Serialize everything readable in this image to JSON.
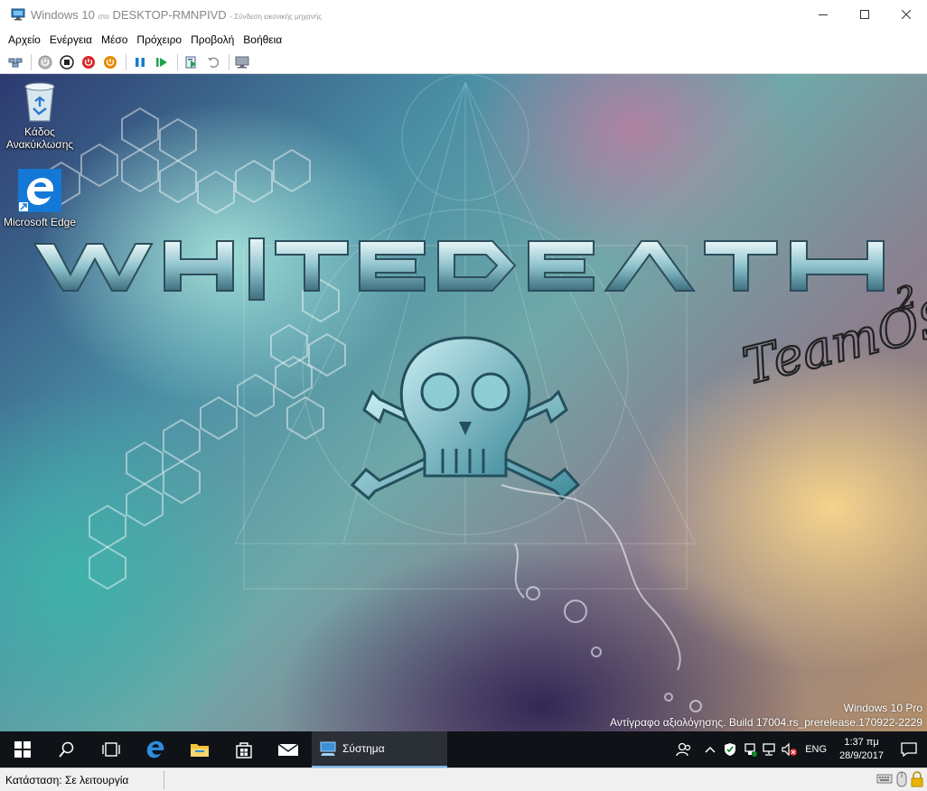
{
  "titlebar": {
    "title": "Windows 10",
    "on": "στο",
    "host": "DESKTOP-RMNPIVD",
    "subtitle": "- Σύνδεση εικονικής μηχανής",
    "icon": "vm-connection-icon",
    "controls": [
      "minimize-icon",
      "maximize-icon",
      "close-icon"
    ]
  },
  "menubar": {
    "items": [
      "Αρχείο",
      "Ενέργεια",
      "Μέσο",
      "Πρόχειρο",
      "Προβολή",
      "Βοήθεια"
    ]
  },
  "toolbar": {
    "buttons": [
      "ctrl-alt-del-icon",
      "start-icon",
      "turn-off-icon",
      "shutdown-icon",
      "save-icon",
      "pause-icon",
      "resume-icon",
      "checkpoint-icon",
      "revert-icon",
      "enhanced-session-icon"
    ],
    "colors": {
      "red": "#d9262b",
      "orange": "#e68a00",
      "blue": "#1a7cc9",
      "green": "#1aa64a"
    }
  },
  "desktop": {
    "icons": [
      {
        "label_line1": "Κάδος",
        "label_line2": "Ανακύκλωσης",
        "icon": "recycle-bin-icon"
      },
      {
        "label_line1": "Microsoft Edge",
        "label_line2": "",
        "icon": "edge-icon"
      }
    ],
    "wallpaper_text": "WHITEDEATH",
    "wallpaper_sub": "TeamOS",
    "wallpaper_sub2": "2",
    "watermark_line1": "Windows 10 Pro",
    "watermark_line2": "Αντίγραφο αξιολόγησης. Build 17004.rs_prerelease.170922-2229"
  },
  "taskbar": {
    "buttons": [
      "windows-start-icon",
      "search-icon",
      "task-view-icon",
      "edge-icon",
      "file-explorer-icon",
      "store-icon",
      "mail-icon"
    ],
    "active_app": {
      "label": "Σύστημα",
      "icon": "system-icon"
    },
    "tray": {
      "icons": [
        "people-icon",
        "chevron-up-icon",
        "defender-icon",
        "usb-icon",
        "network-icon",
        "volume-muted-icon"
      ],
      "language": "ENG",
      "time": "1:37 πμ",
      "date": "28/9/2017",
      "notifications_icon": "action-center-icon"
    },
    "accent": "#76b9ed"
  },
  "statusbar": {
    "status": "Κατάσταση: Σε λειτουργία",
    "icons": [
      "keyboard-icon",
      "mouse-capture-icon",
      "lock-icon"
    ]
  }
}
